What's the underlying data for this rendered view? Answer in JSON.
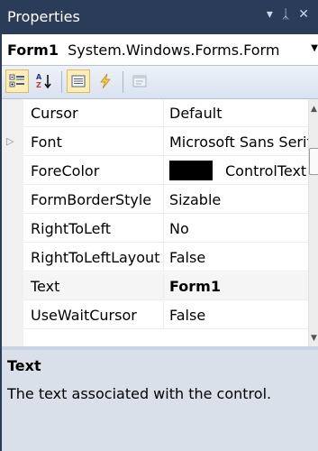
{
  "window": {
    "title": "Properties"
  },
  "titlebar": {
    "dropdown_icon": "▾",
    "pin_icon": "ᛣ",
    "close_icon": "✕"
  },
  "object_selector": {
    "name": "Form1",
    "type": "System.Windows.Forms.Form"
  },
  "toolbar": {
    "buttons": [
      {
        "icon": "categorized-icon",
        "active": true
      },
      {
        "icon": "alphabetical-icon",
        "active": false
      },
      {
        "icon": "properties-icon",
        "active": true
      },
      {
        "icon": "events-icon",
        "active": false
      },
      {
        "icon": "property-pages-icon",
        "active": false
      }
    ]
  },
  "properties": [
    {
      "name": "Cursor",
      "value": "Default"
    },
    {
      "name": "Font",
      "value": "Microsoft Sans Serif",
      "expandable": true
    },
    {
      "name": "ForeColor",
      "value": "ControlText",
      "swatch": "#000000"
    },
    {
      "name": "FormBorderStyle",
      "value": "Sizable"
    },
    {
      "name": "RightToLeft",
      "value": "No"
    },
    {
      "name": "RightToLeftLayout",
      "value": "False"
    },
    {
      "name": "Text",
      "value": "Form1",
      "bold": true,
      "selected": true
    },
    {
      "name": "UseWaitCursor",
      "value": "False"
    }
  ],
  "description": {
    "title": "Text",
    "text": "The text associated with the control."
  },
  "colors": {
    "titlebar": "#2b3c59",
    "description_bg": "#d9e0ea",
    "active_button": "#fdedb6"
  }
}
